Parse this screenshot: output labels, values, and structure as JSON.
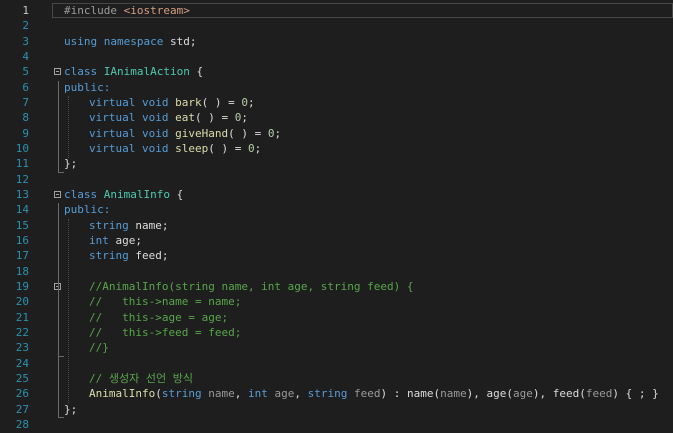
{
  "editor": {
    "current_line": 1,
    "line_numbers": [
      "1",
      "2",
      "3",
      "4",
      "5",
      "6",
      "7",
      "8",
      "9",
      "10",
      "11",
      "12",
      "13",
      "14",
      "15",
      "16",
      "17",
      "18",
      "19",
      "20",
      "21",
      "22",
      "23",
      "24",
      "25",
      "26",
      "27",
      "28"
    ],
    "tokens": {
      "include_directive": "#include",
      "include_header": "<iostream>",
      "using": "using",
      "namespace": "namespace",
      "std": "std",
      "class": "class",
      "class1_name": "IAnimalAction",
      "public": "public:",
      "virtual": "virtual",
      "void": "void",
      "m_bark": "bark",
      "m_eat": "eat",
      "m_giveHand": "giveHand",
      "m_sleep": "sleep",
      "pure_tail": "( ) = ",
      "zero": "0",
      "class2_name": "AnimalInfo",
      "string": "string",
      "int": "int",
      "f_name": "name",
      "f_age": "age",
      "f_feed": "feed",
      "ctor_comment_1": "//AnimalInfo(string name, int age, string feed) {",
      "ctor_comment_2": "//   this->name = name;",
      "ctor_comment_3": "//   this->age = age;",
      "ctor_comment_4": "//   this->feed = feed;",
      "ctor_comment_5": "//}",
      "korean_comment": "// 생성자 선언 방식",
      "ctor_name": "AnimalInfo",
      "init_tail": "{ ; }"
    }
  }
}
